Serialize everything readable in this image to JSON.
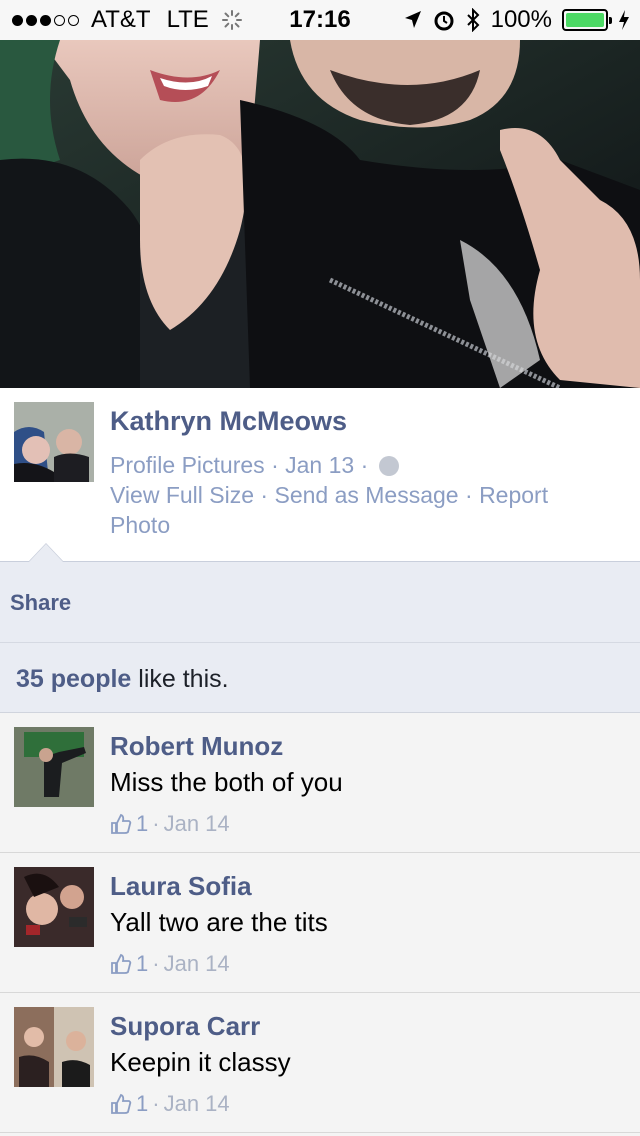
{
  "status_bar": {
    "carrier": "AT&T",
    "network": "LTE",
    "time": "17:16",
    "battery": "100%",
    "battery_level": 1.0,
    "signal_bars_filled": 3,
    "signal_bars_total": 5
  },
  "post": {
    "author": "Kathryn McMeows",
    "album": "Profile Pictures",
    "date": "Jan 13",
    "sep": "·",
    "actions": {
      "view_full_size": "View Full Size",
      "send_as_message": "Send as Message",
      "report_photo": "Report Photo"
    }
  },
  "share": {
    "label": "Share"
  },
  "likes": {
    "count_label": "35 people",
    "suffix": " like this."
  },
  "comments": [
    {
      "name": "Robert Munoz",
      "text": "Miss the both of you",
      "likes": "1",
      "date": "Jan 14"
    },
    {
      "name": "Laura Sofia",
      "text": "Yall two are the tits",
      "likes": "1",
      "date": "Jan 14"
    },
    {
      "name": "Supora Carr",
      "text": "Keepin it classy",
      "likes": "1",
      "date": "Jan 14"
    }
  ],
  "colors": {
    "link_blue": "#4e5d87",
    "meta_blue": "#8b9dc3",
    "share_bg": "#e9ecf3",
    "battery_green": "#4cd964"
  }
}
